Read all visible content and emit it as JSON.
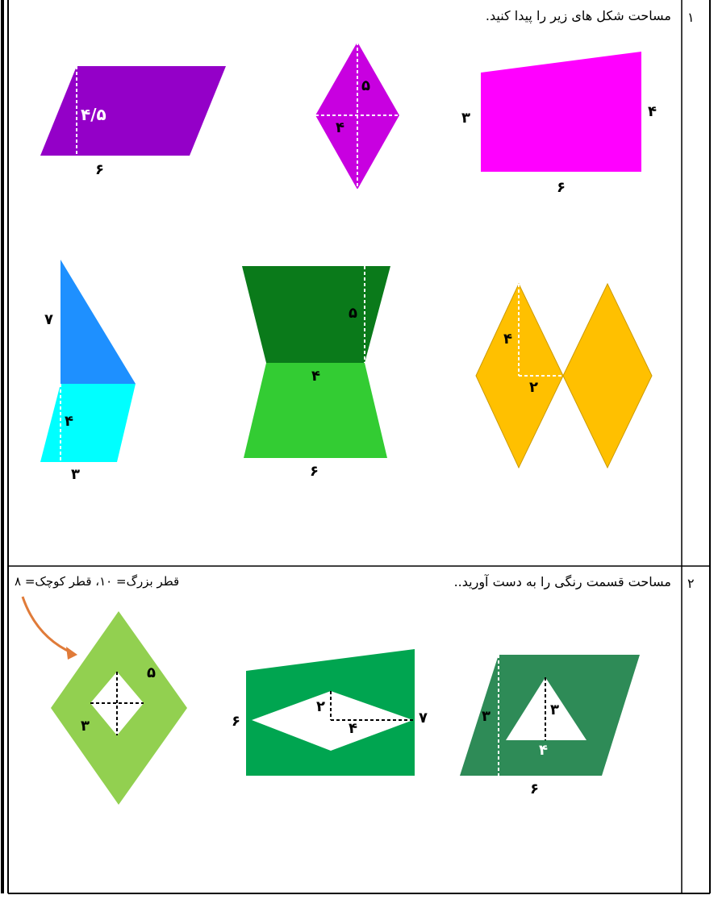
{
  "q1": {
    "number": "۱",
    "instruction": "مساحت شکل های زیر را پیدا کنید.",
    "labels": {
      "parallelogram_height": "۴/۵",
      "parallelogram_base": "۶",
      "rhombus_half_long": "۵",
      "rhombus_half_short": "۴",
      "trapezoid_left": "۳",
      "trapezoid_right": "۴",
      "trapezoid_base": "۶",
      "triangle_height": "۷",
      "blue_para_height": "۴",
      "blue_para_base": "۳",
      "hourglass_height": "۵",
      "hourglass_mid": "۴",
      "hourglass_base": "۶",
      "twin_half_long": "۴",
      "twin_half_short": "۲"
    },
    "colors": {
      "parallelogram": "#9400c8",
      "rhombus": "#c800e0",
      "trapezoid": "#ff00ff",
      "triangle": "#1e90ff",
      "cyan_para": "#00ffff",
      "dark_green": "#0a7a1a",
      "light_green": "#33cc33",
      "orange": "#ffc000"
    }
  },
  "q2": {
    "number": "۲",
    "instruction": "مساحت قسمت رنگی را به دست آورید..",
    "note": "قطر بزرگ= ۱۰، قطر کوچک= ۸",
    "labels": {
      "rhombus_a": "۵",
      "rhombus_b": "۳",
      "trap_left": "۶",
      "trap_right": "۷",
      "inner_short": "۲",
      "inner_long": "۴",
      "para_height": "۳",
      "tri_height": "۳",
      "tri_half": "۴",
      "para_base": "۶"
    },
    "colors": {
      "lime": "#92d050",
      "green": "#00a550",
      "sea_green": "#2e8b57",
      "arrow": "#e07b39"
    }
  }
}
